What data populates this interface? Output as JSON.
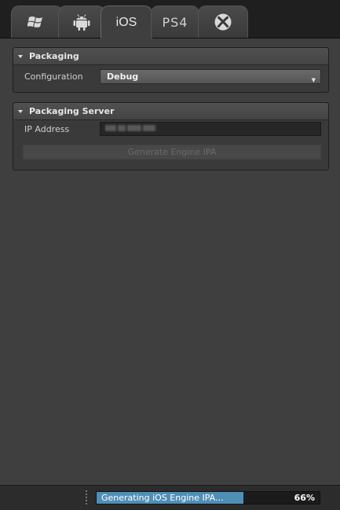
{
  "tabs": [
    {
      "name": "windows",
      "icon": "windows-logo-icon",
      "label": ""
    },
    {
      "name": "android",
      "icon": "android-icon",
      "label": ""
    },
    {
      "name": "ios",
      "icon": "",
      "label": "iOS",
      "active": true
    },
    {
      "name": "ps4",
      "icon": "ps4-logo-icon",
      "label": "PS4"
    },
    {
      "name": "xbox",
      "icon": "xbox-logo-icon",
      "label": ""
    }
  ],
  "packaging": {
    "title": "Packaging",
    "configuration_label": "Configuration",
    "configuration_value": "Debug"
  },
  "packaging_server": {
    "title": "Packaging Server",
    "ip_label": "IP Address",
    "ip_value": "",
    "generate_button": "Generate Engine IPA"
  },
  "status": {
    "progress_text": "Generating iOS Engine IPA...",
    "progress_percent_text": "66%",
    "progress_fraction": 0.66,
    "progress_color": "#4f8fb6"
  }
}
